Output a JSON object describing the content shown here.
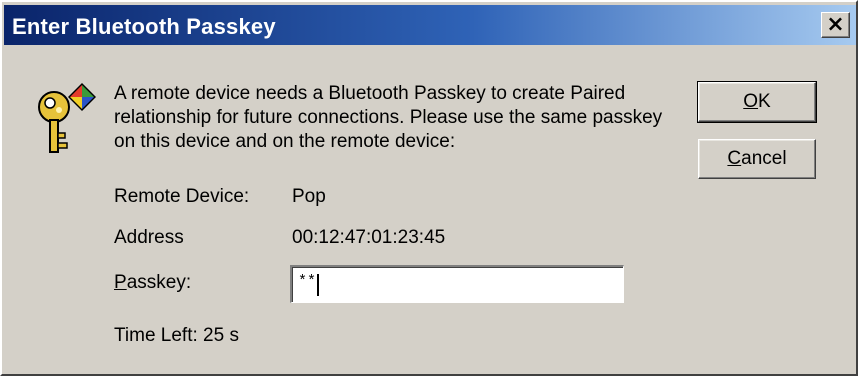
{
  "window": {
    "title": "Enter Bluetooth Passkey",
    "close_glyph": "×"
  },
  "dialog": {
    "icon": "bluetooth-key-icon",
    "message": "A remote device needs a Bluetooth Passkey to create Paired relationship for future connections. Please use the same passkey on this device and on the remote device:",
    "remote_device_label": "Remote Device:",
    "remote_device_value": "Pop",
    "address_label": "Address",
    "address_value": "00:12:47:01:23:45",
    "passkey_label_prefix": "P",
    "passkey_label_rest": "asskey:",
    "passkey_masked_value": "**",
    "time_left": "Time Left: 25 s"
  },
  "buttons": {
    "ok_accel": "O",
    "ok_rest": "K",
    "cancel_accel": "C",
    "cancel_rest": "ancel"
  },
  "colors": {
    "titlebar_start": "#0a246a",
    "titlebar_end": "#a6caf0",
    "face": "#d4d0c8"
  }
}
